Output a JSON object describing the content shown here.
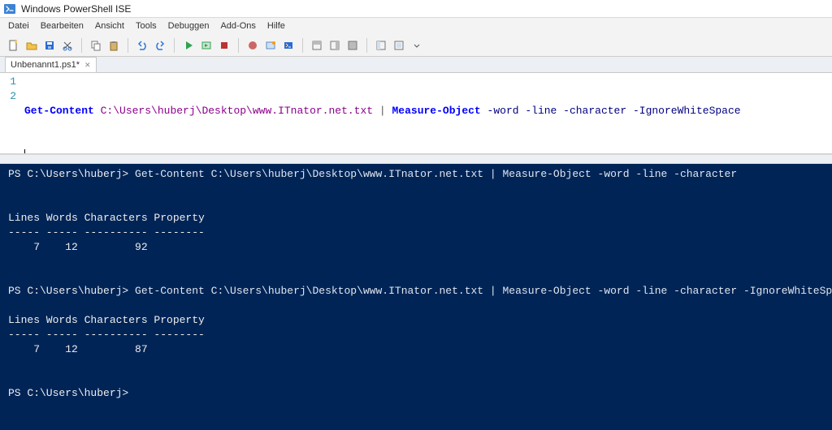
{
  "window": {
    "title": "Windows PowerShell ISE"
  },
  "menu": {
    "items": [
      "Datei",
      "Bearbeiten",
      "Ansicht",
      "Tools",
      "Debuggen",
      "Add-Ons",
      "Hilfe"
    ]
  },
  "tab": {
    "label": "Unbenannt1.ps1*"
  },
  "script": {
    "line1_cmd1": "Get-Content",
    "line1_path": " C:\\Users\\huberj\\Desktop\\www.ITnator.net.txt ",
    "line1_pipe": "|",
    "line1_cmd2": " Measure-Object",
    "line1_params": " -word -line -character -IgnoreWhiteSpace",
    "gutter": [
      "1",
      "2"
    ]
  },
  "console": {
    "prompt": "PS C:\\Users\\huberj>",
    "cmd1": " Get-Content C:\\Users\\huberj\\Desktop\\www.ITnator.net.txt | Measure-Object -word -line -character",
    "header": "Lines Words Characters Property",
    "underline": "----- ----- ---------- --------",
    "row1": "    7    12         92",
    "cmd2": " Get-Content C:\\Users\\huberj\\Desktop\\www.ITnator.net.txt | Measure-Object -word -line -character -IgnoreWhiteSpace",
    "row2": "    7    12         87"
  }
}
